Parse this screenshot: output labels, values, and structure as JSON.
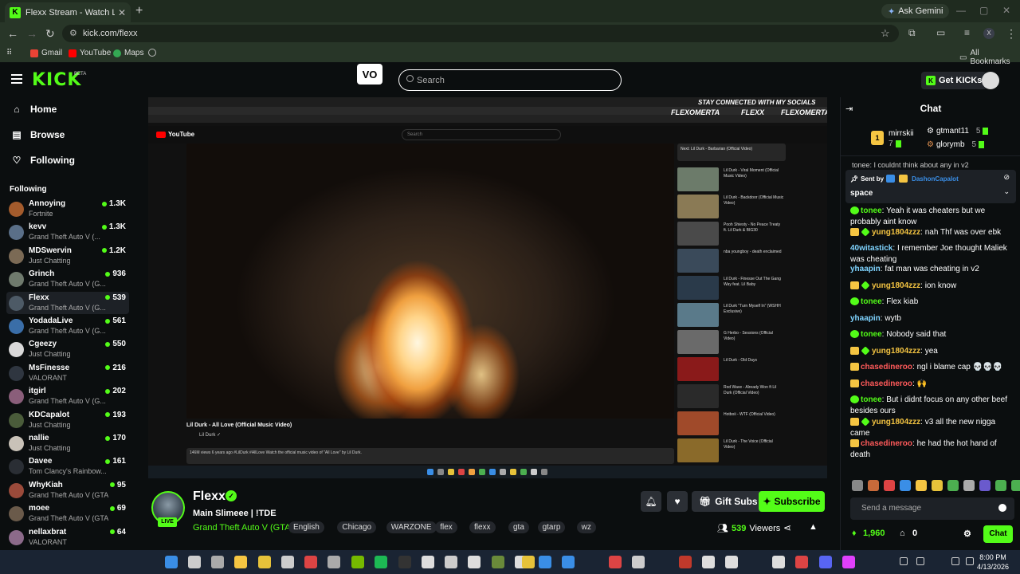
{
  "browser": {
    "tab_title": "Flexx Stream - Watch Live on Kick",
    "tab_icon": "K",
    "ask_gemini": "Ask Gemini",
    "url": "kick.com/flexx",
    "bookmarks": [
      "Gmail",
      "YouTube",
      "Maps"
    ],
    "all_bookmarks": "All Bookmarks",
    "profile_initial": "X"
  },
  "kick": {
    "logo": "KICK",
    "beta": "BETA",
    "vo_label": "V⃞",
    "search_placeholder": "Search",
    "get_kicks": "Get KICKs",
    "accent": "#53fc18"
  },
  "sidebar": {
    "nav": [
      {
        "label": "Home",
        "icon": "home-icon"
      },
      {
        "label": "Browse",
        "icon": "browse-icon"
      },
      {
        "label": "Following",
        "icon": "heart-icon"
      }
    ],
    "following_header": "Following",
    "channels": [
      {
        "name": "Annoying",
        "category": "Fortnite",
        "viewers": "1.3K",
        "color": "#a35b2c"
      },
      {
        "name": "kevv",
        "category": "Grand Theft Auto V (...",
        "viewers": "1.3K",
        "color": "#5a6f88"
      },
      {
        "name": "MDSwervin",
        "category": "Just Chatting",
        "viewers": "1.2K",
        "color": "#7b6a55"
      },
      {
        "name": "Grinch",
        "category": "Grand Theft Auto V (G...",
        "viewers": "936",
        "color": "#6f7a6d"
      },
      {
        "name": "Flexx",
        "category": "Grand Theft Auto V (G...",
        "viewers": "539",
        "color": "#4d5a66"
      },
      {
        "name": "YodadaLive",
        "category": "Grand Theft Auto V (G...",
        "viewers": "561",
        "color": "#3a6ea8"
      },
      {
        "name": "Cgeezy",
        "category": "Just Chatting",
        "viewers": "550",
        "color": "#d9d9d9"
      },
      {
        "name": "MsFinesse",
        "category": "VALORANT",
        "viewers": "216",
        "color": "#2f3640"
      },
      {
        "name": "itgirl",
        "category": "Grand Theft Auto V (G...",
        "viewers": "202",
        "color": "#8a5e7a"
      },
      {
        "name": "KDCapalot",
        "category": "Just Chatting",
        "viewers": "193",
        "color": "#4a5c3a"
      },
      {
        "name": "nallie",
        "category": "Just Chatting",
        "viewers": "170",
        "color": "#c9c2b8"
      },
      {
        "name": "Davee",
        "category": "Tom Clancy's Rainbow...",
        "viewers": "161",
        "color": "#2a2e34"
      },
      {
        "name": "WhyKiah",
        "category": "Grand Theft Auto V (GTA)",
        "viewers": "95",
        "color": "#9a4a3a"
      },
      {
        "name": "moee",
        "category": "Grand Theft Auto V (GTA)",
        "viewers": "69",
        "color": "#6a5a4a"
      },
      {
        "name": "nellaxbrat",
        "category": "VALORANT",
        "viewers": "64",
        "color": "#8c6a8a"
      }
    ]
  },
  "video": {
    "social_banner": "STAY CONNECTED WITH MY SOCIALS",
    "flexo1": "FLEXOMERTA",
    "flexo2": "FLEXX",
    "flexo3": "FLEXOMERTA",
    "yt_brand": "YouTube",
    "yt_search": "Search",
    "yt_video_title": "Lil Durk - All Love (Official Music Video)",
    "yt_channel": "Lil Durk ✓",
    "yt_desc": "146M views 6 years ago #LilDurk #AllLove  Watch the official music video of \"All Love\" by Lil Durk.",
    "yt_upnext": "Next: Lil Durk - Barbarian (Official Video)",
    "yt_recs": [
      {
        "title": "Lil Durk - Viral Moment (Official Music Video)",
        "color": "#6c7b6a"
      },
      {
        "title": "Lil Durk - Backdoor (Official Music Video)",
        "color": "#8a7a55"
      },
      {
        "title": "Pooh Shiesty - No Peace Treaty ft. Lil Durk & BIG30",
        "color": "#4a4a4a"
      },
      {
        "title": "nba youngboy - death enclaimed",
        "color": "#3a4a5a"
      },
      {
        "title": "Lil Durk - Finesse Out The Gang Way feat. Lil Baby",
        "color": "#2a3a4a"
      },
      {
        "title": "Lil Durk \"Turn Myself In\" (WSHH Exclusive)",
        "color": "#5a7a8a"
      },
      {
        "title": "G Herbo - Sessions (Official Video)",
        "color": "#6a6a6a"
      },
      {
        "title": "Lil Durk - Old Days",
        "color": "#8a1a1a"
      },
      {
        "title": "Rod Wave - Already Won ft Lil Durk (Official Video)",
        "color": "#2a2a2a"
      },
      {
        "title": "Hotboii - WTF (Official Video)",
        "color": "#a04a2a"
      },
      {
        "title": "Lil Durk - The Voice (Official Video)",
        "color": "#8a6a2a"
      }
    ]
  },
  "stream": {
    "channel_name": "Flexx",
    "title": "Main Slimeee | !TDE",
    "category": "Grand Theft Auto V (GTA)",
    "tags": [
      "English",
      "Chicago",
      "WARZONE",
      "flex",
      "flexx",
      "gta",
      "gtarp",
      "wz"
    ],
    "live_badge": "LIVE",
    "viewers": "539",
    "viewers_label": "Viewers",
    "gift_subs": "Gift Subs",
    "subscribe": "Subscribe"
  },
  "chat": {
    "title": "Chat",
    "gifters": [
      {
        "name": "mirrskii",
        "count": "7",
        "rank": "1"
      },
      {
        "name": "gtmant11",
        "count": "5"
      },
      {
        "name": "glorymb",
        "count": "5"
      }
    ],
    "partial_top": "tonee: I couldnt think about any in v2",
    "pinned_sent_by": "Sent by",
    "pinned_user": "DashonCapalot",
    "pinned_msg": "space",
    "messages": [
      {
        "user": "tonee",
        "color": "#53fc18",
        "text": "Yeah it was cheaters but we probably aint know"
      },
      {
        "user": "yung1804zzz",
        "color": "#f5c542",
        "text": "nah Thf was over ebk"
      },
      {
        "user": "40witastick",
        "color": "#7fd4ff",
        "text": "I remember Joe thought Maliek was cheating"
      },
      {
        "user": "yhaapin",
        "color": "#7fd4ff",
        "text": "fat man was cheating in v2"
      },
      {
        "user": "yung1804zzz",
        "color": "#f5c542",
        "text": "ion know"
      },
      {
        "user": "tonee",
        "color": "#53fc18",
        "text": "Flex kiab"
      },
      {
        "user": "yhaapin",
        "color": "#7fd4ff",
        "text": "wytb"
      },
      {
        "user": "tonee",
        "color": "#53fc18",
        "text": "Nobody said that"
      },
      {
        "user": "yung1804zzz",
        "color": "#f5c542",
        "text": "yea"
      },
      {
        "user": "chasedineroo",
        "color": "#ff5a5a",
        "text": "ngl i blame cap 💀💀💀"
      },
      {
        "user": "chasedineroo",
        "color": "#ff5a5a",
        "text": "🙌"
      },
      {
        "user": "tonee",
        "color": "#53fc18",
        "text": "But i didnt focus on any other beef besides ours"
      },
      {
        "user": "yung1804zzz",
        "color": "#f5c542",
        "text": "v3 all the new nigga came"
      },
      {
        "user": "chasedineroo",
        "color": "#ff5a5a",
        "text": "he had the hot hand of death"
      }
    ],
    "input_placeholder": "Send a message",
    "kicks_balance": "1,960",
    "points": "0",
    "chat_button": "Chat"
  },
  "taskbar": {
    "time": "8:00 PM",
    "date": "4/13/2026"
  }
}
